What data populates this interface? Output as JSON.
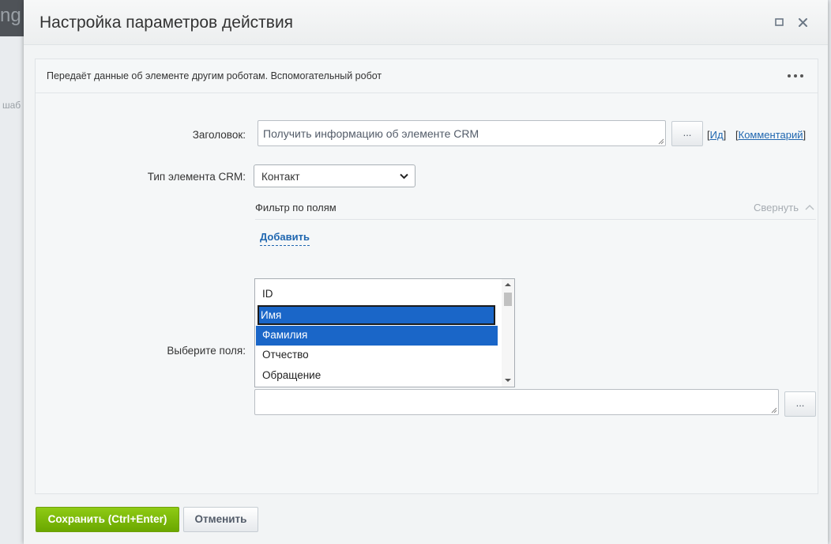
{
  "background": {
    "logo_fragment": "ng",
    "side_text": "шаб"
  },
  "dialog": {
    "title": "Настройка параметров действия",
    "maximize_icon": "maximize-icon",
    "close_icon": "close-icon"
  },
  "robot": {
    "description": "Передаёт данные об элементе другим роботам. Вспомогательный робот",
    "menu_icon": "more-dots-icon"
  },
  "form": {
    "title_label": "Заголовок:",
    "title_value": "Получить информацию об элементе CRM",
    "title_picker_label": "...",
    "id_link_open": "[",
    "id_link": "Ид",
    "id_link_close": "]",
    "comment_link_open": "[",
    "comment_link": "Комментарий",
    "comment_link_close": "]",
    "entity_type_label": "Тип элемента CRM:",
    "entity_type_value": "Контакт",
    "filter_title": "Фильтр по полям",
    "collapse_label": "Свернуть",
    "add_label": "Добавить",
    "fields_label": "Выберите поля:",
    "fields_options": [
      {
        "label": "ID",
        "selected": false
      },
      {
        "label": "Имя",
        "selected": true,
        "focused": true
      },
      {
        "label": "Фамилия",
        "selected": true
      },
      {
        "label": "Отчество",
        "selected": false
      },
      {
        "label": "Обращение",
        "selected": false
      }
    ],
    "fields_picker_label": "..."
  },
  "footer": {
    "save_label": "Сохранить (Ctrl+Enter)",
    "cancel_label": "Отменить"
  },
  "colors": {
    "save_green": "#7ab80b",
    "link_blue": "#2067b0",
    "selection_blue": "#1a66c8"
  }
}
